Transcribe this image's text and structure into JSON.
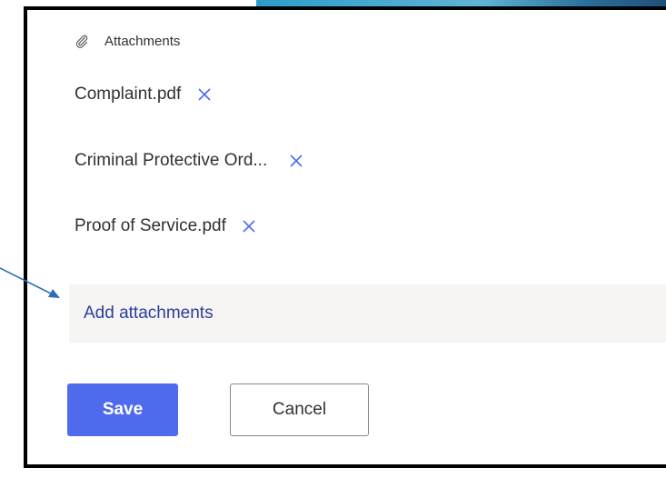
{
  "attachments_section": {
    "title": "Attachments",
    "icon": "paperclip-icon",
    "files": [
      {
        "name": "Complaint.pdf",
        "remove_icon": "close-icon"
      },
      {
        "name": "Criminal Protective Ord...",
        "remove_icon": "close-icon"
      },
      {
        "name": "Proof of Service.pdf",
        "remove_icon": "close-icon"
      }
    ],
    "add_label": "Add attachments"
  },
  "actions": {
    "save_label": "Save",
    "cancel_label": "Cancel"
  },
  "colors": {
    "accent": "#4f6bed",
    "link": "#2b3e9a",
    "remove_icon": "#4f6bed",
    "callout_arrow": "#2e6fb7",
    "add_area_bg": "#f6f5f4",
    "frame_border": "#000000"
  }
}
